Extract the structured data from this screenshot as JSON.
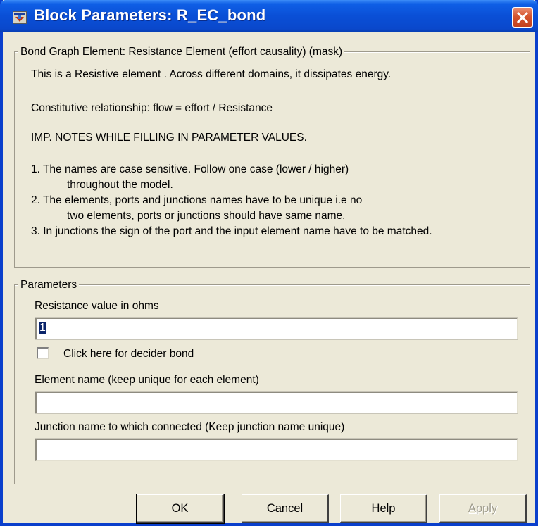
{
  "window": {
    "title": "Block Parameters: R_EC_bond",
    "icon": "simulink-block-icon",
    "close_icon": "close-x-icon"
  },
  "description": {
    "group_title": "Bond Graph Element:  Resistance Element (effort causality) (mask)",
    "lines": [
      "This is a Resistive element . Across different domains, it dissipates energy.",
      "Constitutive relationship: flow = effort / Resistance",
      "IMP. NOTES WHILE FILLING IN PARAMETER VALUES.",
      "1. The names are case sensitive. Follow one case (lower / higher)",
      "throughout the model.",
      "2. The elements, ports and junctions names have to be unique i.e no",
      "two elements, ports or junctions should have same name.",
      "3. In junctions the sign of the port and the input element name have to be matched."
    ]
  },
  "parameters": {
    "group_title": "Parameters",
    "resistance": {
      "label": "Resistance value in ohms",
      "value": "1"
    },
    "decider_bond": {
      "label": "Click here for decider bond",
      "checked": false
    },
    "element_name": {
      "label": "Element name (keep unique for each element)",
      "value": ""
    },
    "junction_name": {
      "label": "Junction name to which connected (Keep junction name unique)",
      "value": ""
    }
  },
  "buttons": {
    "ok": {
      "mnemonic": "O",
      "rest": "K"
    },
    "cancel": {
      "mnemonic": "C",
      "rest": "ancel"
    },
    "help": {
      "mnemonic": "H",
      "rest": "elp"
    },
    "apply": {
      "mnemonic": "A",
      "rest": "pply",
      "enabled": false
    }
  },
  "colors": {
    "titlebar": "#0A4FD6",
    "window_face": "#ECE9D8",
    "close_button": "#D5542E",
    "selection": "#0A246A",
    "disabled_text": "#A19E8E"
  }
}
